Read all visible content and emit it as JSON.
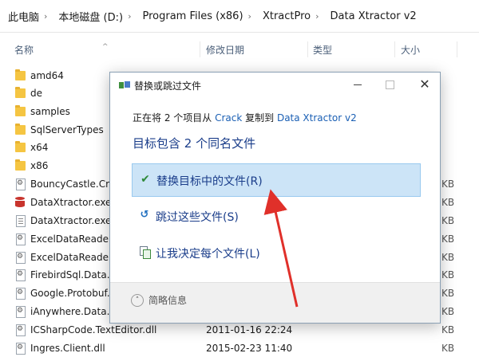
{
  "breadcrumb": [
    "此电脑",
    "本地磁盘 (D:)",
    "Program Files (x86)",
    "XtractPro",
    "Data Xtractor v2"
  ],
  "columns": {
    "name": "名称",
    "date": "修改日期",
    "type": "类型",
    "size": "大小"
  },
  "files": [
    {
      "name": "amd64",
      "icon": "folder-icon",
      "date": "",
      "size": ""
    },
    {
      "name": "de",
      "icon": "folder-icon",
      "date": "",
      "size": ""
    },
    {
      "name": "samples",
      "icon": "folder-icon",
      "date": "",
      "size": ""
    },
    {
      "name": "SqlServerTypes",
      "icon": "folder-icon",
      "date": "",
      "size": ""
    },
    {
      "name": "x64",
      "icon": "folder-icon",
      "date": "",
      "size": ""
    },
    {
      "name": "x86",
      "icon": "folder-icon",
      "date": "",
      "size": ""
    },
    {
      "name": "BouncyCastle.Crypt",
      "icon": "dll-icon",
      "date": "",
      "size": "KB"
    },
    {
      "name": "DataXtractor.exe",
      "icon": "exe-icon",
      "date": "",
      "size": "KB"
    },
    {
      "name": "DataXtractor.exe.co",
      "icon": "config-icon",
      "date": "",
      "size": "KB"
    },
    {
      "name": "ExcelDataReader.D",
      "icon": "dll-icon",
      "date": "",
      "size": "KB"
    },
    {
      "name": "ExcelDataReader.d",
      "icon": "dll-icon",
      "date": "",
      "size": "KB"
    },
    {
      "name": "FirebirdSql.Data.Fir",
      "icon": "dll-icon",
      "date": "",
      "size": "KB"
    },
    {
      "name": "Google.Protobuf.dll",
      "icon": "dll-icon",
      "date": "",
      "size": "KB"
    },
    {
      "name": "iAnywhere.Data.SQ",
      "icon": "dll-icon",
      "date": "",
      "size": "KB"
    },
    {
      "name": "ICSharpCode.TextEditor.dll",
      "icon": "dll-icon",
      "date": "2011-01-16 22:24",
      "size": "KB"
    },
    {
      "name": "Ingres.Client.dll",
      "icon": "dll-icon",
      "date": "2015-02-23 11:40",
      "size": "KB"
    }
  ],
  "dialog": {
    "title": "替换或跳过文件",
    "copy_prefix": "正在将 2 个项目从 ",
    "copy_source": "Crack",
    "copy_middle": " 复制到 ",
    "copy_dest": "Data Xtractor v2",
    "heading": "目标包含 2 个同名文件",
    "options": [
      {
        "label": "替换目标中的文件(R)",
        "icon": "check-icon",
        "selected": true
      },
      {
        "label": "跳过这些文件(S)",
        "icon": "skip-icon",
        "selected": false
      },
      {
        "label": "让我决定每个文件(L)",
        "icon": "decide-icon",
        "selected": false
      }
    ],
    "details_label": "简略信息"
  },
  "colors": {
    "selection": "#cce4f7",
    "link": "#1a5fb4",
    "heading": "#1a3d8a",
    "arrow": "#e0302a"
  }
}
